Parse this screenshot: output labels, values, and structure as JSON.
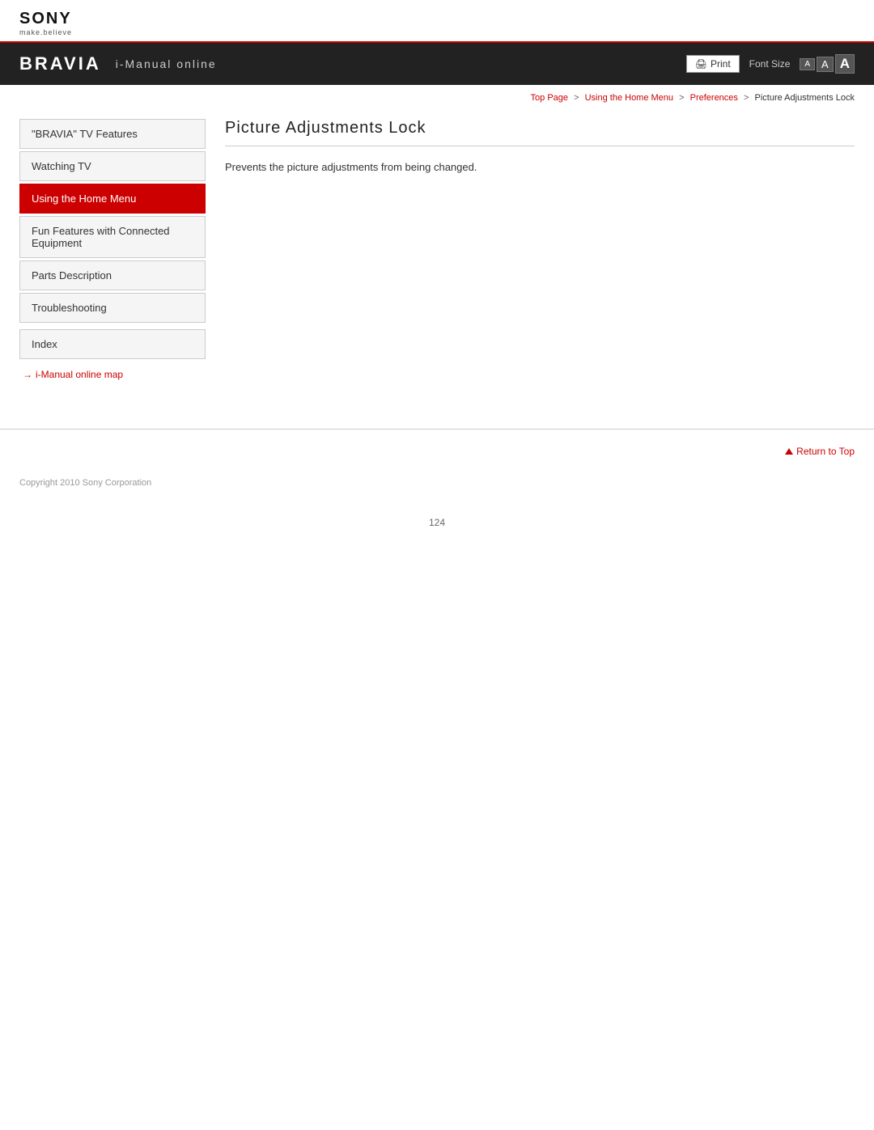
{
  "sony": {
    "logo": "SONY",
    "tagline": "make.believe"
  },
  "header": {
    "brand": "BRAVIA",
    "subtitle": "i-Manual online",
    "print_label": "Print",
    "font_size_label": "Font Size",
    "font_btns": [
      "A",
      "A",
      "A"
    ]
  },
  "breadcrumb": {
    "items": [
      {
        "label": "Top Page",
        "link": true
      },
      {
        "label": "Using the Home Menu",
        "link": true
      },
      {
        "label": "Preferences",
        "link": true
      },
      {
        "label": "Picture Adjustments Lock",
        "link": false
      }
    ]
  },
  "sidebar": {
    "items": [
      {
        "label": "\"BRAVIA\" TV Features",
        "active": false,
        "id": "bravia-features"
      },
      {
        "label": "Watching TV",
        "active": false,
        "id": "watching-tv"
      },
      {
        "label": "Using the Home Menu",
        "active": true,
        "id": "home-menu"
      },
      {
        "label": "Fun Features with Connected Equipment",
        "active": false,
        "id": "fun-features"
      },
      {
        "label": "Parts Description",
        "active": false,
        "id": "parts-description"
      },
      {
        "label": "Troubleshooting",
        "active": false,
        "id": "troubleshooting"
      }
    ],
    "index_label": "Index",
    "map_link_label": "i-Manual online map",
    "arrow": "→"
  },
  "content": {
    "page_title": "Picture Adjustments Lock",
    "description": "Prevents the picture adjustments from being changed."
  },
  "return_to_top": "Return to Top",
  "footer": {
    "copyright": "Copyright 2010 Sony Corporation"
  },
  "page_number": "124"
}
